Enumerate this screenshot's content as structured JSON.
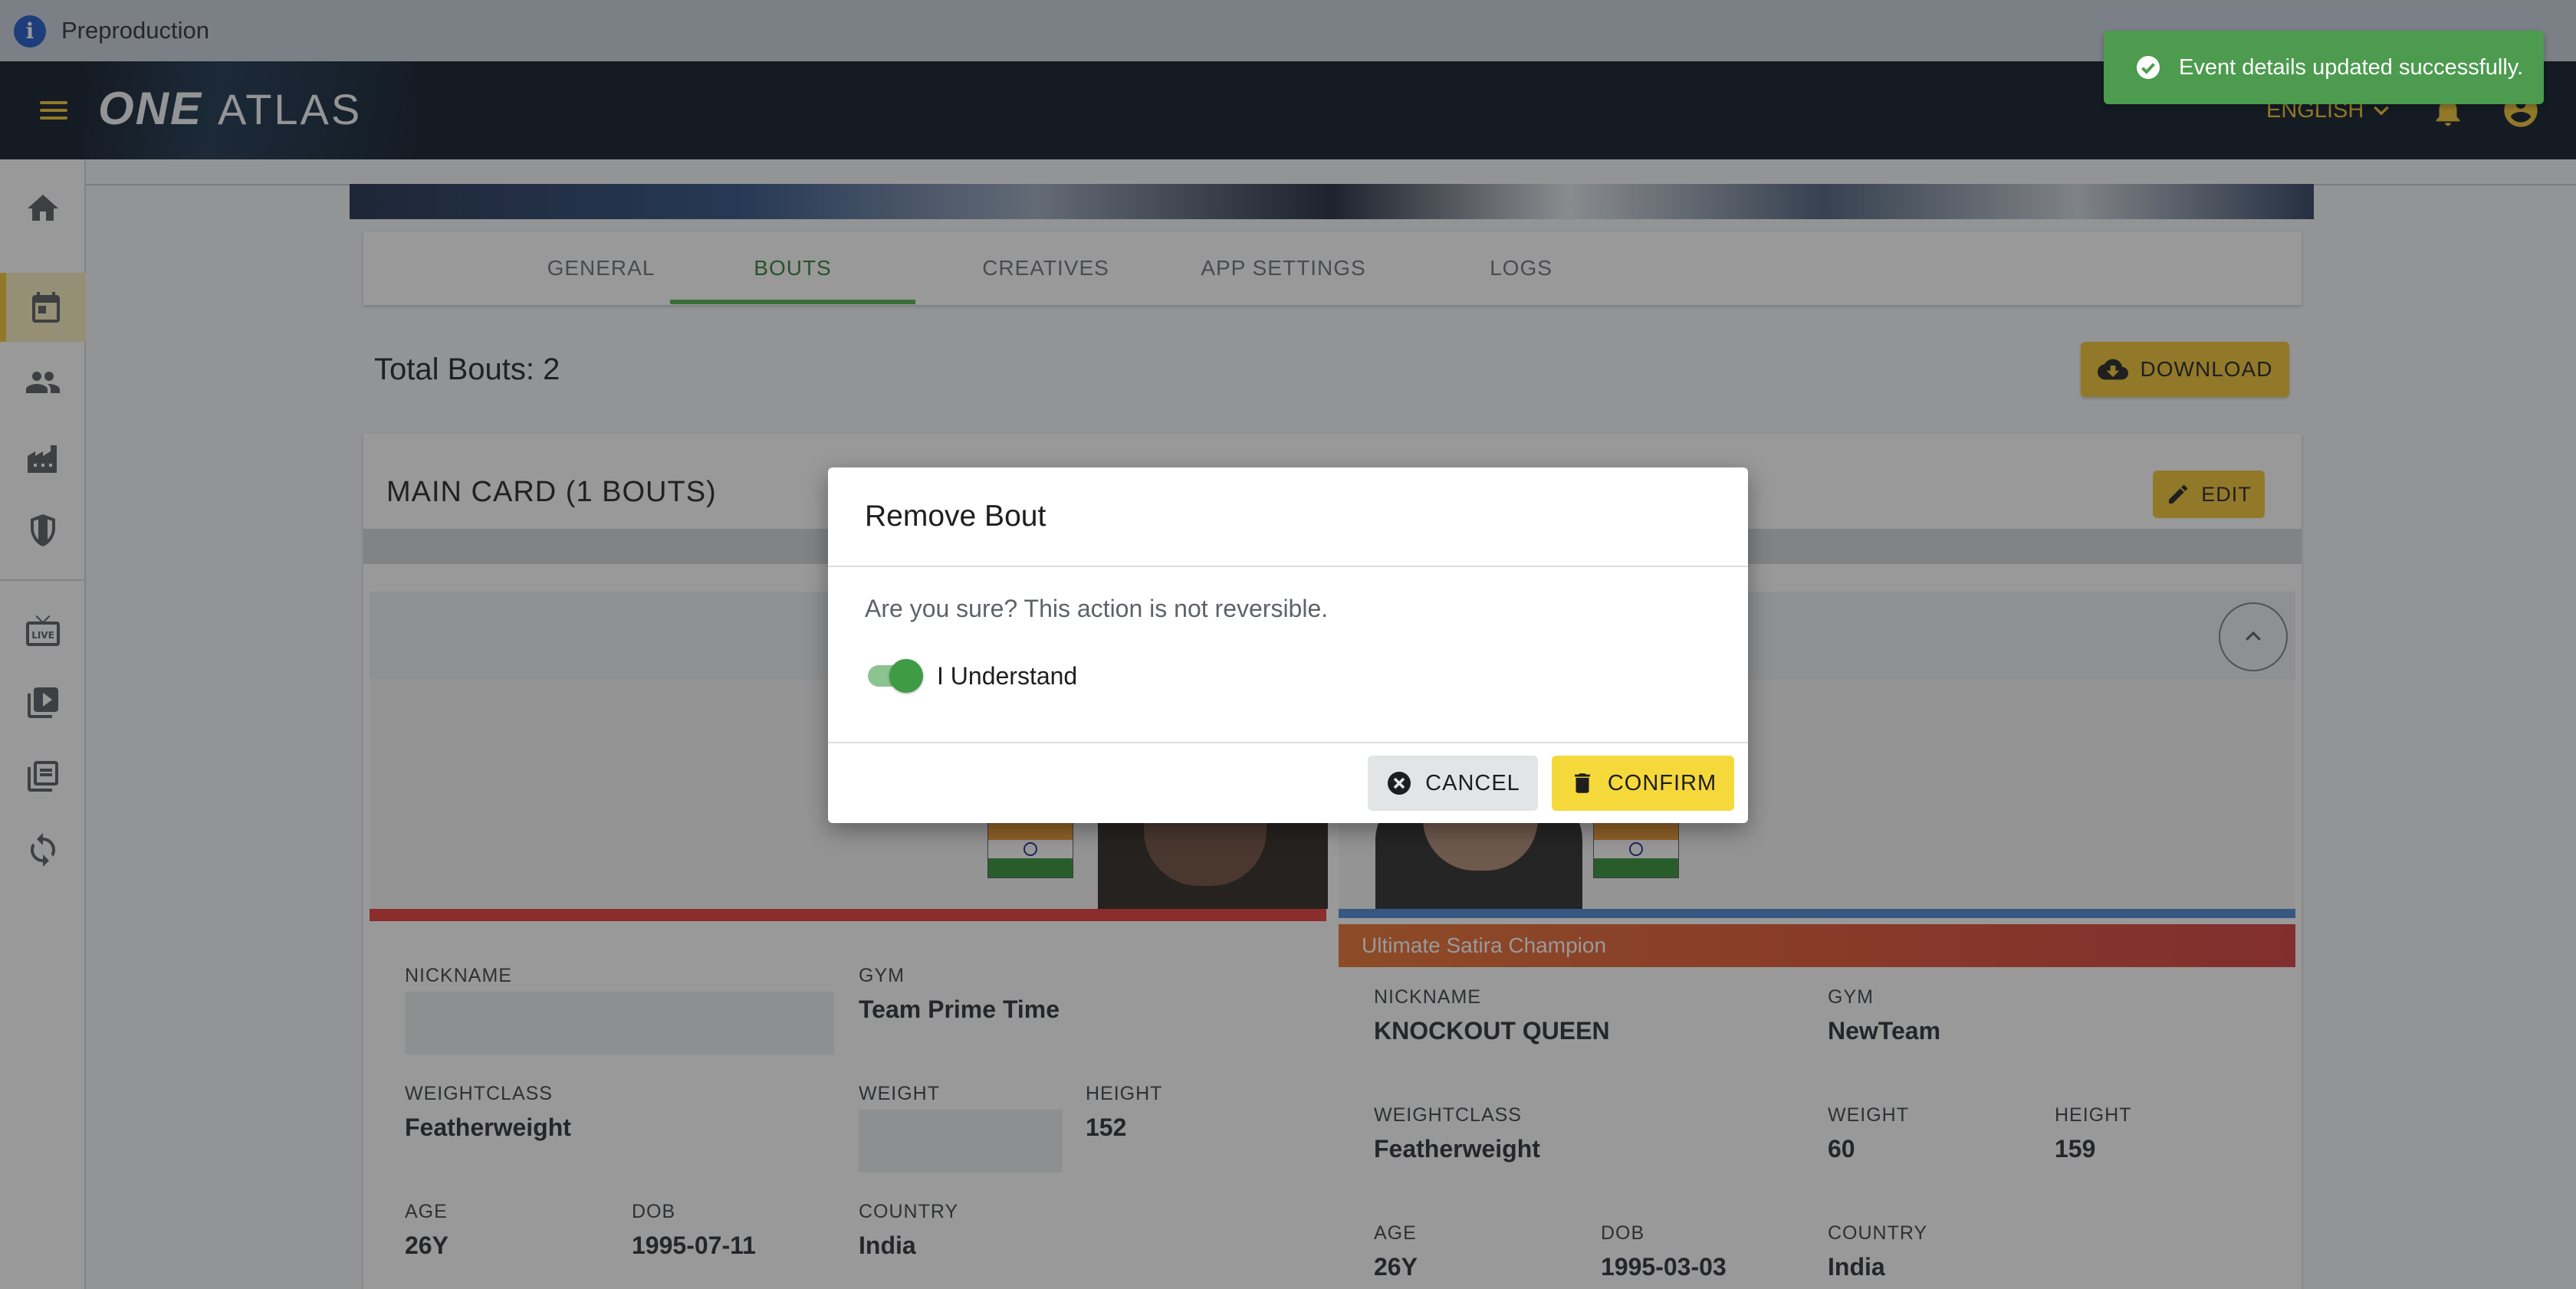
{
  "env": {
    "label": "Preproduction"
  },
  "brand": {
    "word1": "ONE",
    "word2": "ATLAS"
  },
  "header": {
    "language": "ENGLISH"
  },
  "toast": {
    "message": "Event details updated successfully."
  },
  "sidebar": {
    "items": [
      {
        "name": "home",
        "icon": "home-icon"
      },
      {
        "name": "events",
        "icon": "calendar-icon",
        "active": true
      },
      {
        "name": "athletes",
        "icon": "people-icon"
      },
      {
        "name": "venues",
        "icon": "buildings-icon"
      },
      {
        "name": "organizations",
        "icon": "shield-icon"
      },
      {
        "name": "live",
        "icon": "live-tv-icon"
      },
      {
        "name": "videos",
        "icon": "video-library-icon"
      },
      {
        "name": "media",
        "icon": "photo-library-icon"
      },
      {
        "name": "sync",
        "icon": "sync-icon"
      }
    ]
  },
  "tabs": [
    {
      "label": "GENERAL"
    },
    {
      "label": "BOUTS",
      "active": true
    },
    {
      "label": "CREATIVES"
    },
    {
      "label": "APP SETTINGS"
    },
    {
      "label": "LOGS"
    }
  ],
  "bouts": {
    "total_label": "Total Bouts: 2",
    "download_label": "DOWNLOAD",
    "main_card_title": "MAIN CARD (1 BOUTS)",
    "edit_label": "EDIT"
  },
  "fighter1": {
    "nickname_label": "NICKNAME",
    "nickname": "",
    "gym_label": "GYM",
    "gym": "Team Prime Time",
    "weightclass_label": "WEIGHTCLASS",
    "weightclass": "Featherweight",
    "weight_label": "WEIGHT",
    "weight": "",
    "height_label": "HEIGHT",
    "height": "152",
    "age_label": "AGE",
    "age": "26Y",
    "dob_label": "DOB",
    "dob": "1995-07-11",
    "country_label": "COUNTRY",
    "country": "India",
    "corner_color": "#e53935"
  },
  "fighter2": {
    "title": "Ultimate Satira Champion",
    "nickname_label": "NICKNAME",
    "nickname": "KNOCKOUT QUEEN",
    "gym_label": "GYM",
    "gym": "NewTeam",
    "weightclass_label": "WEIGHTCLASS",
    "weightclass": "Featherweight",
    "weight_label": "WEIGHT",
    "weight": "60",
    "height_label": "HEIGHT",
    "height": "159",
    "age_label": "AGE",
    "age": "26Y",
    "dob_label": "DOB",
    "dob": "1995-03-03",
    "country_label": "COUNTRY",
    "country": "India",
    "corner_color": "#4a86d6"
  },
  "dialog": {
    "title": "Remove Bout",
    "message": "Are you sure? This action is not reversible.",
    "toggle_label": "I Understand",
    "toggle_on": true,
    "cancel_label": "CANCEL",
    "confirm_label": "CONFIRM"
  },
  "colors": {
    "accent": "#f0c531",
    "success": "#4c9b4f",
    "active_tab": "#2e7d32",
    "appbar": "#0c1726"
  }
}
